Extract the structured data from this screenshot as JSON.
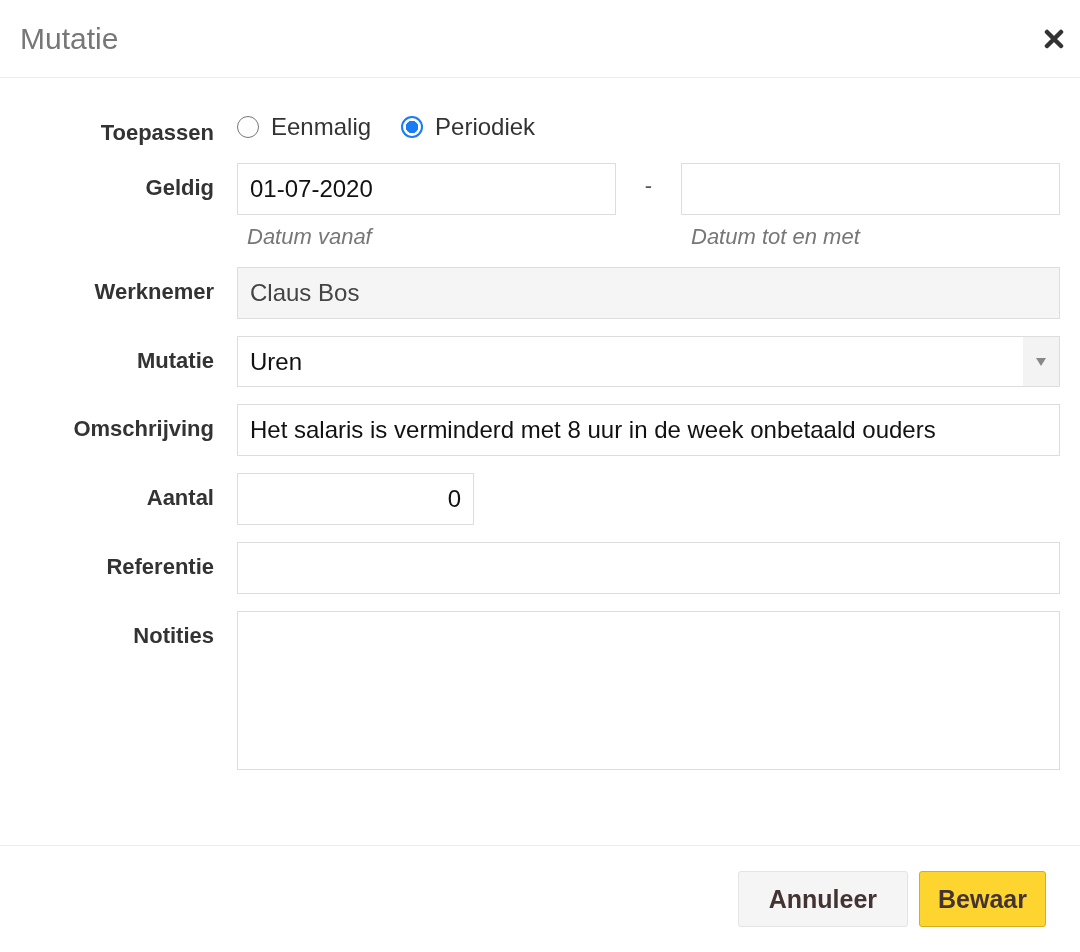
{
  "dialog": {
    "title": "Mutatie"
  },
  "fields": [
    {
      "kind": "radio",
      "label": "Toepassen",
      "options": [
        {
          "label": "Eenmalig",
          "selected": false
        },
        {
          "label": "Periodiek",
          "selected": true
        }
      ]
    },
    {
      "kind": "daterange",
      "label": "Geldig",
      "separator": "-",
      "from": {
        "value": "01-07-2020",
        "hint": "Datum vanaf"
      },
      "to": {
        "hint": "Datum tot en met"
      }
    },
    {
      "kind": "text",
      "label": "Werknemer",
      "value": "Claus Bos",
      "disabled": true
    },
    {
      "kind": "select",
      "label": "Mutatie",
      "value": "Uren"
    },
    {
      "kind": "text",
      "label": "Omschrijving",
      "value": "Het salaris is verminderd met 8 uur in de week onbetaald ouders"
    },
    {
      "kind": "number",
      "label": "Aantal",
      "value": "0"
    },
    {
      "kind": "text",
      "label": "Referentie"
    },
    {
      "kind": "textarea",
      "label": "Notities"
    }
  ],
  "buttons": [
    {
      "label": "Annuleer",
      "primary": false
    },
    {
      "label": "Bewaar",
      "primary": true
    }
  ]
}
